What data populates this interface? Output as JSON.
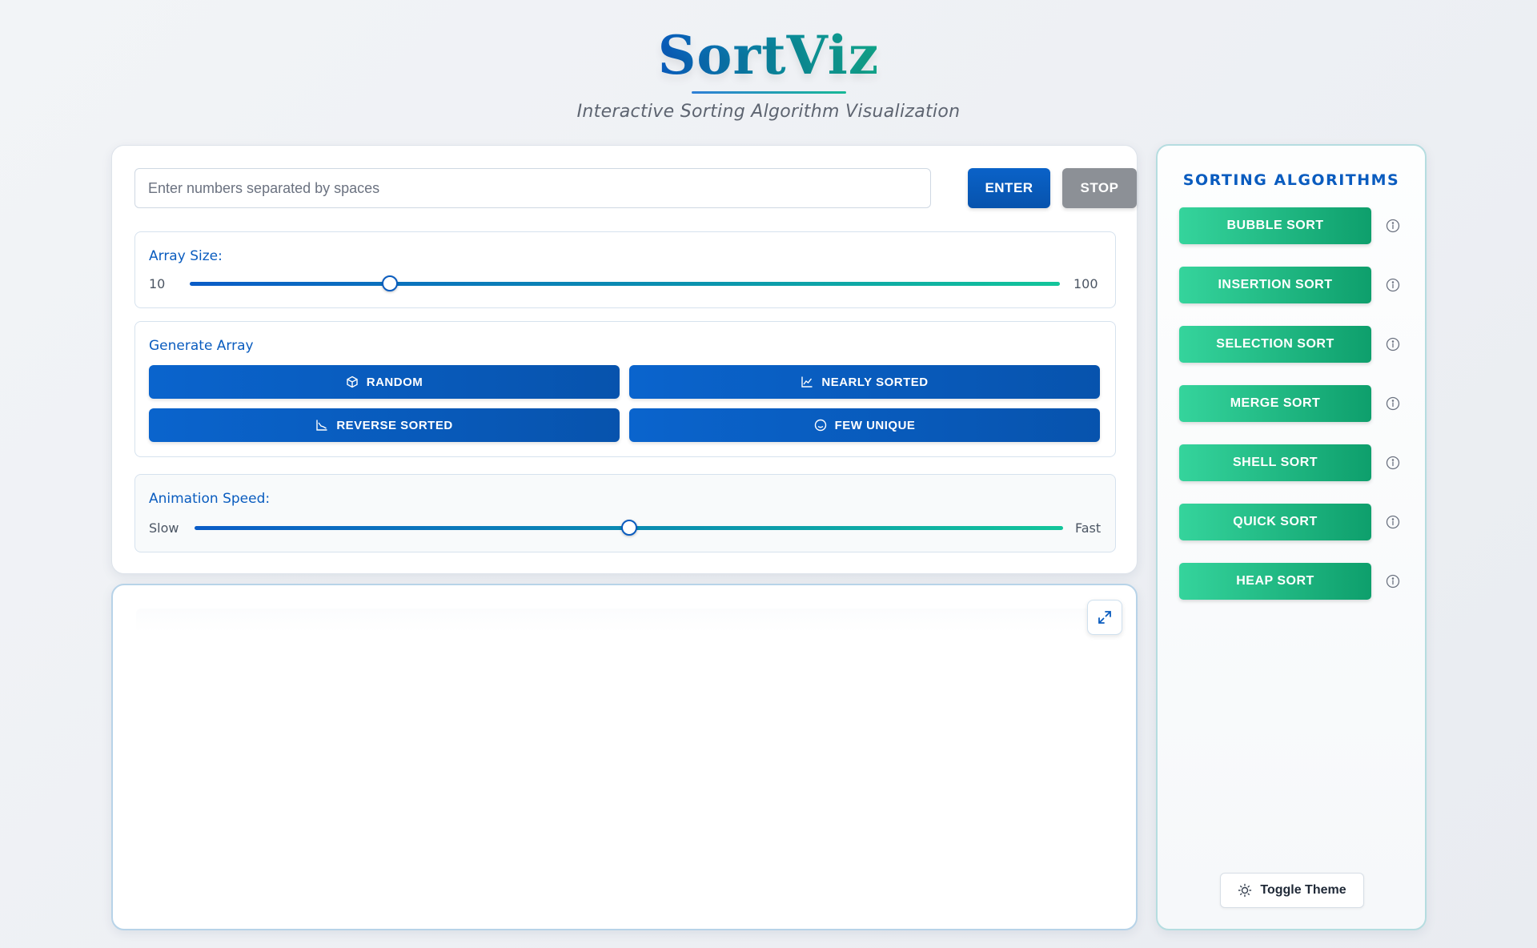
{
  "header": {
    "title": "SortViz",
    "subtitle": "Interactive Sorting Algorithm Visualization"
  },
  "controls": {
    "input_placeholder": "Enter numbers separated by spaces",
    "enter_label": "ENTER",
    "stop_label": "STOP",
    "array_size": {
      "label": "Array Size:",
      "min_label": "10",
      "max_label": "100",
      "min": 10,
      "max": 100,
      "value_fraction": 0.23
    },
    "generate": {
      "label": "Generate Array",
      "buttons": [
        "RANDOM",
        "NEARLY SORTED",
        "REVERSE SORTED",
        "FEW UNIQUE"
      ]
    },
    "speed": {
      "label": "Animation Speed:",
      "min_label": "Slow",
      "max_label": "Fast",
      "value_fraction": 0.5
    }
  },
  "sidebar": {
    "title": "SORTING ALGORITHMS",
    "algorithms": [
      "BUBBLE SORT",
      "INSERTION SORT",
      "SELECTION SORT",
      "MERGE SORT",
      "SHELL SORT",
      "QUICK SORT",
      "HEAP SORT"
    ],
    "toggle_theme_label": "Toggle Theme"
  },
  "icons": {
    "random": "cube-icon",
    "nearly_sorted": "chart-line-icon",
    "reverse_sorted": "chart-descending-icon",
    "few_unique": "smile-circle-icon",
    "expand": "expand-icon",
    "info": "info-icon",
    "theme": "sun-icon"
  },
  "colors": {
    "primary_blue": "#0a5cbf",
    "algo_green": "#1fb882",
    "stop_gray": "#8c9096"
  }
}
